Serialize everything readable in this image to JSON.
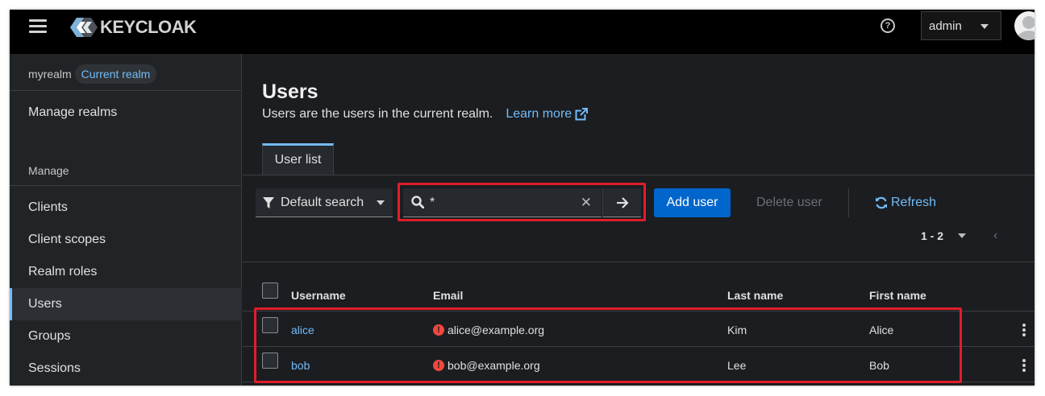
{
  "masthead": {
    "brand": "KEYCLOAK",
    "user_menu": "admin",
    "icons": {
      "menu": "hamburger-icon",
      "help": "help-icon",
      "avatar": "avatar-icon"
    }
  },
  "sidebar": {
    "realm_name": "myrealm",
    "realm_badge": "Current realm",
    "manage_realms": "Manage realms",
    "section_title": "Manage",
    "items": [
      {
        "label": "Clients"
      },
      {
        "label": "Client scopes"
      },
      {
        "label": "Realm roles"
      },
      {
        "label": "Users",
        "active": true
      },
      {
        "label": "Groups"
      },
      {
        "label": "Sessions"
      }
    ]
  },
  "main": {
    "title": "Users",
    "description": "Users are the users in the current realm.",
    "learn_more": "Learn more",
    "tab": "User list",
    "toolbar": {
      "filter_label": "Default search",
      "search_value": "*",
      "add_user": "Add user",
      "delete_user": "Delete user",
      "refresh": "Refresh"
    },
    "pagination": {
      "range": "1 - 2"
    },
    "table": {
      "columns": [
        "Username",
        "Email",
        "Last name",
        "First name"
      ],
      "rows": [
        {
          "username": "alice",
          "email": "alice@example.org",
          "last_name": "Kim",
          "first_name": "Alice"
        },
        {
          "username": "bob",
          "email": "bob@example.org",
          "last_name": "Lee",
          "first_name": "Bob"
        }
      ]
    }
  },
  "colors": {
    "accent_link": "#73bcf7",
    "primary_button": "#0066cc",
    "annotation": "#e11d2a",
    "warning": "#f0473f"
  }
}
